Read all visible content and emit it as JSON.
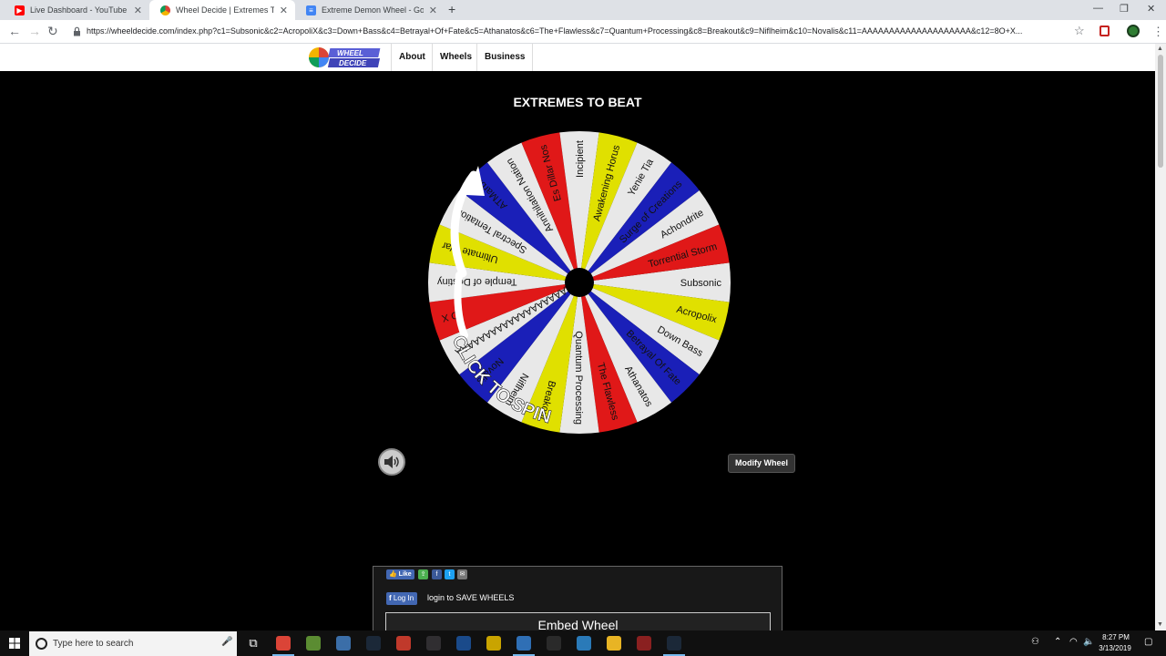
{
  "browser": {
    "tabs": [
      {
        "title": "Live Dashboard - YouTube",
        "favicon": "youtube-icon",
        "color": "#ff0000"
      },
      {
        "title": "Wheel Decide | Extremes To Beat",
        "favicon": "wheeldecide-icon",
        "color": "#f4b400"
      },
      {
        "title": "Extreme Demon Wheel - Google",
        "favicon": "google-docs-icon",
        "color": "#4285f4"
      }
    ],
    "url": "https://wheeldecide.com/index.php?c1=Subsonic&c2=AcropoliX&c3=Down+Bass&c4=Betrayal+Of+Fate&c5=Athanatos&c6=The+Flawless&c7=Quantum+Processing&c8=Breakout&c9=Niflheim&c10=Novalis&c11=AAAAAAAAAAAAAAAAAAAA&c12=8O+X..."
  },
  "site": {
    "logo_text": "WHEEL DECIDE",
    "nav": [
      {
        "label": "About"
      },
      {
        "label": "Wheels"
      },
      {
        "label": "Business"
      }
    ]
  },
  "wheel": {
    "title": "EXTREMES TO BEAT",
    "spin_label": "CLICK TO SPIN",
    "segment_colors": [
      "#e8e8e8",
      "#e0e000",
      "#e8e8e8",
      "#1a1fb8",
      "#e8e8e8",
      "#e01818"
    ],
    "entries": [
      "Subsonic",
      "Acropolix",
      "Down Bass",
      "Betrayal Of Fate",
      "Athanatos",
      "The Flawless",
      "Quantum Processing",
      "Breakout",
      "Niflheim",
      "Novalis",
      "AAAAAAAAAAAAAAAAAAAA",
      "O X",
      "Temple of Destiny",
      "Ultimate War",
      "Spectral Tentation",
      "ATMarbl",
      "Annihilation Nation",
      "Es Dillar Nos",
      "Incipient",
      "Awakening Horus",
      "Yenie Tia",
      "Surge of Creations",
      "Achondrite",
      "Torrential Storm"
    ]
  },
  "controls": {
    "modify_label": "Modify Wheel",
    "sound_icon": "speaker-icon"
  },
  "share": {
    "like_label": "Like",
    "login_label": "Log In",
    "login_text": "login to SAVE WHEELS",
    "embed_label": "Embed Wheel"
  },
  "taskbar": {
    "search_placeholder": "Type here to search",
    "time": "8:27 PM",
    "date": "3/13/2019",
    "apps": [
      {
        "name": "chrome-icon",
        "color": "#db4437",
        "running": true
      },
      {
        "name": "minecraft-icon",
        "color": "#5b8c32",
        "running": false
      },
      {
        "name": "photo-app-icon",
        "color": "#3b6ea8",
        "running": false
      },
      {
        "name": "steam-icon",
        "color": "#1b2838",
        "running": false
      },
      {
        "name": "media-app-icon",
        "color": "#c0392b",
        "running": false
      },
      {
        "name": "obs-icon",
        "color": "#302e31",
        "running": false
      },
      {
        "name": "dark-app-icon",
        "color": "#1a4a8a",
        "running": false
      },
      {
        "name": "geometry-dash-icon",
        "color": "#c9a400",
        "running": false
      },
      {
        "name": "paint-app-icon",
        "color": "#2f6fb5",
        "running": true
      },
      {
        "name": "terminal-icon",
        "color": "#2a2a2a",
        "running": false
      },
      {
        "name": "files-app-icon",
        "color": "#2a7ab8",
        "running": false
      },
      {
        "name": "file-explorer-icon",
        "color": "#e8b424",
        "running": false
      },
      {
        "name": "game-app-icon",
        "color": "#8a2020",
        "running": false
      },
      {
        "name": "steam-running-icon",
        "color": "#1b2838",
        "running": true
      }
    ]
  }
}
